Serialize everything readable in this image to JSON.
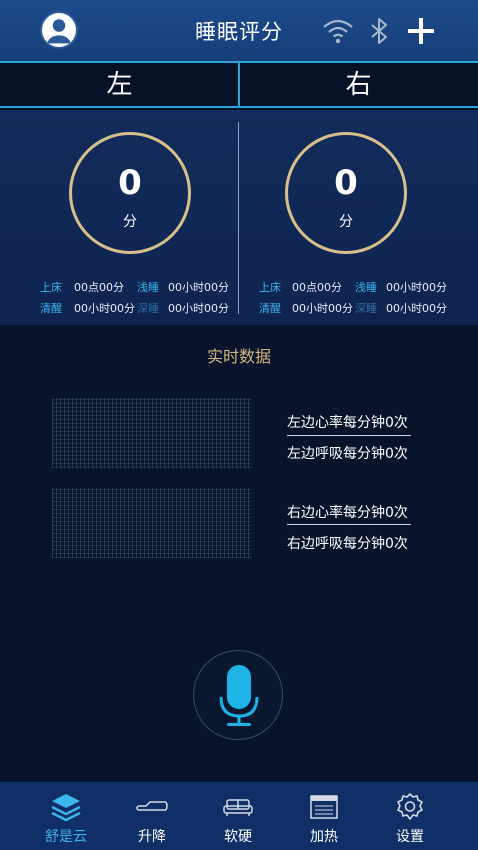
{
  "header": {
    "title": "睡眠评分",
    "icons": [
      "avatar-icon",
      "wifi-icon",
      "bluetooth-icon",
      "plus-icon"
    ]
  },
  "sides": {
    "left": "左",
    "right": "右"
  },
  "left_panel": {
    "score": "0",
    "unit": "分",
    "bed_label": "上床",
    "bed_value": "00点00分",
    "light_label": "浅睡",
    "light_value": "00小时00分",
    "awake_label": "清醒",
    "awake_value": "00小时00分",
    "deep_label": "深睡",
    "deep_value": "00小时00分"
  },
  "right_panel": {
    "score": "0",
    "unit": "分",
    "bed_label": "上床",
    "bed_value": "00点00分",
    "light_label": "浅睡",
    "light_value": "00小时00分",
    "awake_label": "清醒",
    "awake_value": "00小时00分",
    "deep_label": "深睡",
    "deep_value": "00小时00分"
  },
  "realtime": {
    "title": "实时数据",
    "left_heart": "左边心率每分钟0次",
    "left_breath": "左边呼吸每分钟0次",
    "right_heart": "右边心率每分钟0次",
    "right_breath": "右边呼吸每分钟0次"
  },
  "nav": {
    "items": [
      {
        "label": "舒是云",
        "icon": "layers-icon",
        "active": true
      },
      {
        "label": "升降",
        "icon": "bed-lift-icon",
        "active": false
      },
      {
        "label": "软硬",
        "icon": "sofa-icon",
        "active": false
      },
      {
        "label": "加热",
        "icon": "heater-icon",
        "active": false
      },
      {
        "label": "设置",
        "icon": "gear-icon",
        "active": false
      }
    ]
  },
  "colors": {
    "accent": "#2ea3d8",
    "ring": "#d8c08a",
    "active": "#3bb6ee",
    "gold": "#d6b77c"
  }
}
